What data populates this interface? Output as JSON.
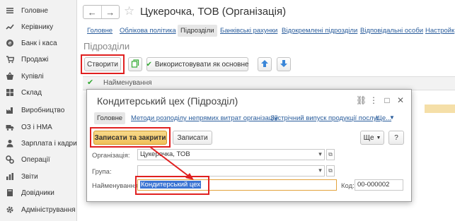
{
  "sidebar": {
    "items": [
      {
        "label": "Головне",
        "icon": "menu-icon"
      },
      {
        "label": "Керівнику",
        "icon": "trend-icon"
      },
      {
        "label": "Банк і каса",
        "icon": "coin-icon"
      },
      {
        "label": "Продажі",
        "icon": "cart-icon"
      },
      {
        "label": "Купівлі",
        "icon": "basket-icon"
      },
      {
        "label": "Склад",
        "icon": "grid-icon"
      },
      {
        "label": "Виробництво",
        "icon": "factory-icon"
      },
      {
        "label": "ОЗ і НМА",
        "icon": "truck-icon"
      },
      {
        "label": "Зарплата і кадри",
        "icon": "person-icon"
      },
      {
        "label": "Операції",
        "icon": "gears-icon"
      },
      {
        "label": "Звіти",
        "icon": "bars-icon"
      },
      {
        "label": "Довідники",
        "icon": "book-icon"
      },
      {
        "label": "Адміністрування",
        "icon": "gear-icon"
      }
    ]
  },
  "header": {
    "back_icon": "←",
    "forward_icon": "→",
    "title": "Цукерочка, ТОВ (Організація)"
  },
  "tabs": [
    {
      "label": "Головне"
    },
    {
      "label": "Облікова політика"
    },
    {
      "label": "Підрозділи"
    },
    {
      "label": "Банківські рахунки"
    },
    {
      "label": "Відокремлені підрозділи"
    },
    {
      "label": "Відповідальні особи"
    },
    {
      "label": "Настройк"
    }
  ],
  "section": {
    "title": "Підрозділи",
    "create_label": "Створити",
    "use_default_label": "Використовувати як основне"
  },
  "list": {
    "column_name": "Найменування"
  },
  "modal": {
    "title": "Кондитерський цех (Підрозділ)",
    "tabs": [
      {
        "label": "Головне"
      },
      {
        "label": "Методи розподілу непрямих витрат організацій"
      },
      {
        "label": "Зустрічний випуск продукції послуг"
      },
      {
        "label": "Ще..."
      }
    ],
    "save_close_label": "Записати та закрити",
    "save_label": "Записати",
    "more_label": "Ще",
    "help_label": "?",
    "fields": {
      "organization_label": "Організація:",
      "organization_value": "Цукерочка, ТОВ",
      "group_label": "Група:",
      "group_value": "",
      "name_label": "Найменування:",
      "name_value": "Кондитерський цех",
      "code_label": "Код:",
      "code_value": "00-000002"
    }
  },
  "colors": {
    "highlight": "#e02020",
    "primary_button": "#f0c15a",
    "link": "#2a5d9c",
    "selection": "#3b74d3"
  }
}
